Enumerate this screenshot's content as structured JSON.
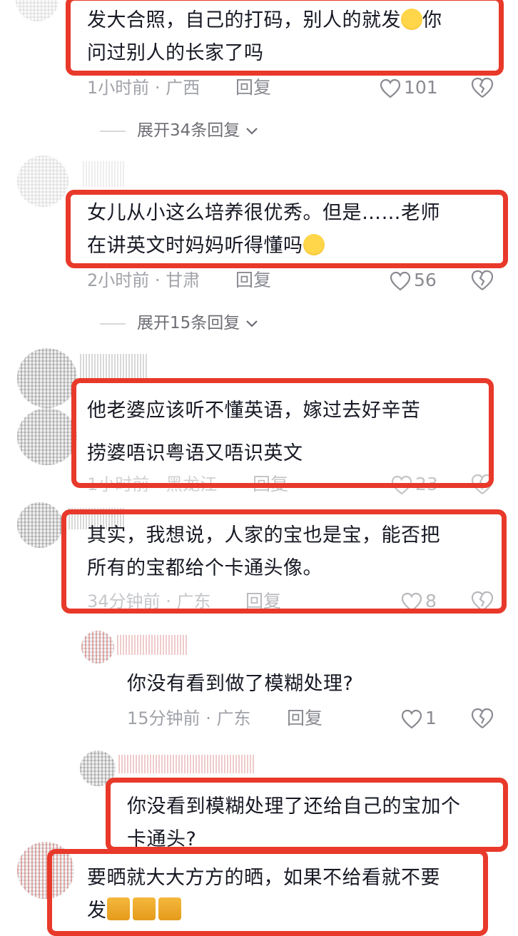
{
  "comments": [
    {
      "text_line1": "发大合照，自己的打码，别人的就发",
      "text_line2": "问过别人的长家了吗",
      "emoji": "rofl-emoji",
      "time": "1小时前",
      "location": "广西",
      "reply_label": "回复",
      "likes": "101",
      "expand_label": "展开34条回复"
    },
    {
      "text_line1": "女儿从小这么培养很优秀。但是……老师",
      "text_line2": "在讲英文时妈妈听得懂吗",
      "emoji": "thinking-emoji",
      "time": "2小时前",
      "location": "甘肃",
      "reply_label": "回复",
      "likes": "56",
      "expand_label": "展开15条回复"
    },
    {
      "text_line1": "他老婆应该听不懂英语，嫁过去好辛苦",
      "text_line2": "捞婆唔识粤语又唔识英文",
      "time": "1小时前",
      "location": "黑龙江",
      "reply_label": "回复",
      "likes": "23"
    },
    {
      "text_line1": "其实，我想说，人家的宝也是宝，能否把",
      "text_line2": "所有的宝都给个卡通头像。",
      "time": "34分钟前",
      "location": "广东",
      "reply_label": "回复",
      "likes": "8"
    },
    {
      "text_line1": "你没有看到做了模糊处理?",
      "time": "15分钟前",
      "location": "广东",
      "reply_label": "回复",
      "likes": "1"
    },
    {
      "text_line1": "你没看到模糊处理了还给自己的宝加个",
      "text_line2": "卡通头?"
    },
    {
      "text_line1": "要晒就大大方方的晒，如果不给看就不要",
      "text_line2": "发",
      "emoji": "cat-emoji"
    }
  ],
  "separator": "·",
  "colors": {
    "highlight": "#e8392a",
    "text": "#161823",
    "meta": "#a0a2a8"
  }
}
